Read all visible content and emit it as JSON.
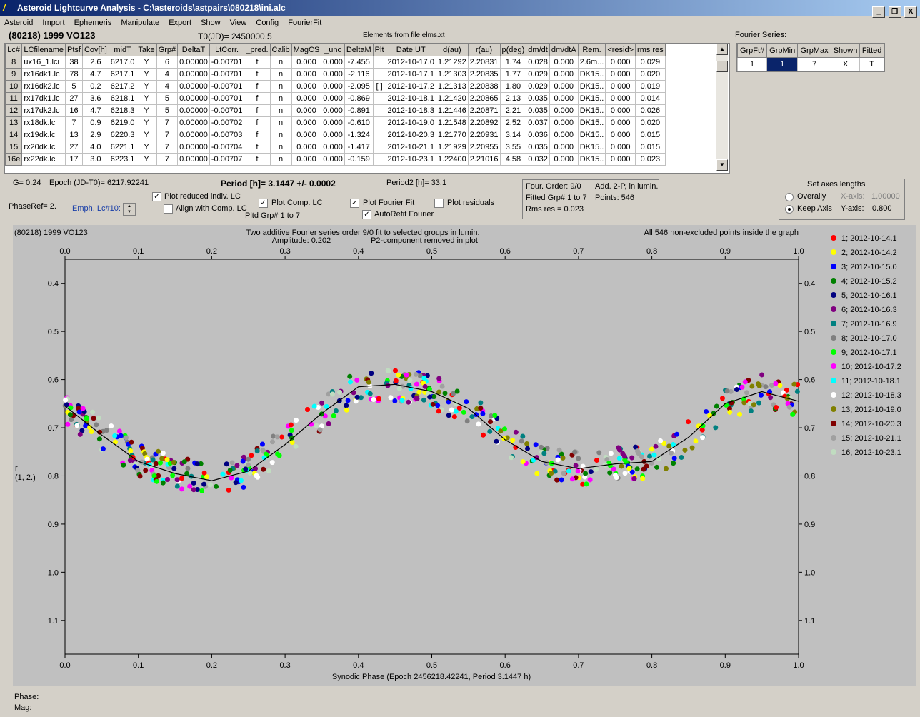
{
  "window": {
    "title": "Asteroid Lightcurve Analysis - C:\\asteroids\\astpairs\\080218\\ini.alc",
    "minimize": "_",
    "restore": "❐",
    "close": "X"
  },
  "menu": [
    "Asteroid",
    "Import",
    "Ephemeris",
    "Manipulate",
    "Export",
    "Show",
    "View",
    "Config",
    "FourierFit"
  ],
  "header": {
    "asteroid": "(80218) 1999 VO123",
    "t0": "T0(JD)= 2450000.5",
    "elements": "Elements from file elms.xt",
    "fourier_label": "Fourier Series:"
  },
  "lc_table": {
    "columns": [
      "Lc#",
      "LCfilename",
      "Ptsf",
      "Cov[h]",
      "midT",
      "Take",
      "Grp#",
      "DeltaT",
      "LtCorr.",
      "_pred.",
      "Calib",
      "MagCS",
      "_unc",
      "DeltaM",
      "Plt",
      "Date UT",
      "d(au)",
      "r(au)",
      "p(deg)",
      "dm/dt",
      "dm/dtA",
      "Rem.",
      "<resid>",
      "rms res"
    ],
    "rows": [
      [
        "8",
        "ux16_1.lci",
        "38",
        "2.6",
        "6217.0",
        "Y",
        "6",
        "0.00000",
        "-0.00701",
        "f",
        "n",
        "0.000",
        "0.000",
        "-7.455",
        "",
        "2012-10-17.0",
        "1.21292",
        "2.20831",
        "1.74",
        "0.028",
        "0.000",
        "2.6m...",
        "0.000",
        "0.029"
      ],
      [
        "9",
        "rx16dk1.lc",
        "78",
        "4.7",
        "6217.1",
        "Y",
        "4",
        "0.00000",
        "-0.00701",
        "f",
        "n",
        "0.000",
        "0.000",
        "-2.116",
        "",
        "2012-10-17.1",
        "1.21303",
        "2.20835",
        "1.77",
        "0.029",
        "0.000",
        "DK15..",
        "0.000",
        "0.020"
      ],
      [
        "10",
        "rx16dk2.lc",
        "5",
        "0.2",
        "6217.2",
        "Y",
        "4",
        "0.00000",
        "-0.00701",
        "f",
        "n",
        "0.000",
        "0.000",
        "-2.095",
        "[ ]",
        "2012-10-17.2",
        "1.21313",
        "2.20838",
        "1.80",
        "0.029",
        "0.000",
        "DK15..",
        "0.000",
        "0.019"
      ],
      [
        "11",
        "rx17dk1.lc",
        "27",
        "3.6",
        "6218.1",
        "Y",
        "5",
        "0.00000",
        "-0.00701",
        "f",
        "n",
        "0.000",
        "0.000",
        "-0.869",
        "",
        "2012-10-18.1",
        "1.21420",
        "2.20865",
        "2.13",
        "0.035",
        "0.000",
        "DK15..",
        "0.000",
        "0.014"
      ],
      [
        "12",
        "rx17dk2.lc",
        "16",
        "4.7",
        "6218.3",
        "Y",
        "5",
        "0.00000",
        "-0.00701",
        "f",
        "n",
        "0.000",
        "0.000",
        "-0.891",
        "",
        "2012-10-18.3",
        "1.21446",
        "2.20871",
        "2.21",
        "0.035",
        "0.000",
        "DK15..",
        "0.000",
        "0.026"
      ],
      [
        "13",
        "rx18dk.lc",
        "7",
        "0.9",
        "6219.0",
        "Y",
        "7",
        "0.00000",
        "-0.00702",
        "f",
        "n",
        "0.000",
        "0.000",
        "-0.610",
        "",
        "2012-10-19.0",
        "1.21548",
        "2.20892",
        "2.52",
        "0.037",
        "0.000",
        "DK15..",
        "0.000",
        "0.020"
      ],
      [
        "14",
        "rx19dk.lc",
        "13",
        "2.9",
        "6220.3",
        "Y",
        "7",
        "0.00000",
        "-0.00703",
        "f",
        "n",
        "0.000",
        "0.000",
        "-1.324",
        "",
        "2012-10-20.3",
        "1.21770",
        "2.20931",
        "3.14",
        "0.036",
        "0.000",
        "DK15..",
        "0.000",
        "0.015"
      ],
      [
        "15",
        "rx20dk.lc",
        "27",
        "4.0",
        "6221.1",
        "Y",
        "7",
        "0.00000",
        "-0.00704",
        "f",
        "n",
        "0.000",
        "0.000",
        "-1.417",
        "",
        "2012-10-21.1",
        "1.21929",
        "2.20955",
        "3.55",
        "0.035",
        "0.000",
        "DK15..",
        "0.000",
        "0.015"
      ],
      [
        "16e",
        "rx22dk.lc",
        "17",
        "3.0",
        "6223.1",
        "Y",
        "7",
        "0.00000",
        "-0.00707",
        "f",
        "n",
        "0.000",
        "0.000",
        "-0.159",
        "",
        "2012-10-23.1",
        "1.22400",
        "2.21016",
        "4.58",
        "0.032",
        "0.000",
        "DK15..",
        "0.000",
        "0.023"
      ]
    ]
  },
  "fourier_table": {
    "columns": [
      "GrpFt#",
      "GrpMin",
      "GrpMax",
      "Shown",
      "Fitted"
    ],
    "row": [
      "1",
      "1",
      "7",
      "X",
      "T"
    ]
  },
  "info": {
    "g": "G= 0.24",
    "epoch": "Epoch (JD-T0)= 6217.92241",
    "period": "Period [h]= 3.1447 +/- 0.0002",
    "period2": "Period2 [h]= 33.1",
    "phaseref": "PhaseRef= 2.",
    "emph": "Emph. Lc#10:",
    "cb_reduced": "Plot reduced indiv. LC",
    "cb_align": "Align with Comp. LC",
    "cb_comp": "Plot Comp. LC",
    "pltd_grp": "Pltd Grp#  1   to   7",
    "cb_fourier": "Plot Fourier Fit",
    "cb_autorefit": "AutoRefit Fourier",
    "cb_resid": "Plot residuals",
    "four_order": "Four. Order:  9/0",
    "add2p": "Add. 2-P, in lumin.",
    "fitted_grp": "Fitted Grp# 1 to 7",
    "points": "Points: 546",
    "rms": "Rms res     = 0.023"
  },
  "axes_box": {
    "title": "Set axes lengths",
    "overally": "Overally",
    "keep": "Keep Axis",
    "xaxis_label": "X-axis:",
    "xaxis_value": "1.00000",
    "yaxis_label": "Y-axis:",
    "yaxis_value": "0.800"
  },
  "chart_data": {
    "type": "scatter",
    "title_left": "(80218) 1999 VO123",
    "title_center": "Two additive Fourier series order 9/0 fit to selected groups in lumin.",
    "subtitle_a": "Amplitude: 0.202",
    "subtitle_b": "P2-component removed in plot",
    "title_right": "All 546 non-excluded points inside the graph",
    "xlabel": "Synodic Phase (Epoch 2456218.42241, Period 3.1447 h)",
    "ylabel": [
      "r",
      "(1, 2.)"
    ],
    "xlim": [
      0.0,
      1.0
    ],
    "ylim": [
      1.17,
      0.35
    ],
    "xticks": [
      "0.0",
      "0.1",
      "0.2",
      "0.3",
      "0.4",
      "0.5",
      "0.6",
      "0.7",
      "0.8",
      "0.9",
      "1.0"
    ],
    "yticks": [
      "0.4",
      "0.5",
      "0.6",
      "0.7",
      "0.8",
      "0.9",
      "1.0",
      "1.1"
    ],
    "fit_curve": {
      "x": [
        0.0,
        0.05,
        0.1,
        0.15,
        0.2,
        0.25,
        0.3,
        0.35,
        0.4,
        0.45,
        0.5,
        0.55,
        0.6,
        0.65,
        0.7,
        0.75,
        0.8,
        0.85,
        0.9,
        0.95,
        1.0
      ],
      "y": [
        0.655,
        0.715,
        0.77,
        0.795,
        0.81,
        0.79,
        0.735,
        0.67,
        0.615,
        0.61,
        0.625,
        0.66,
        0.725,
        0.77,
        0.785,
        0.775,
        0.77,
        0.72,
        0.65,
        0.625,
        0.645
      ]
    },
    "scatter_y_range_note": "points scatter around fit curve",
    "series": [
      {
        "name": "1; 2012-10-14.1",
        "color": "#ff0000"
      },
      {
        "name": "2; 2012-10-14.2",
        "color": "#ffff00"
      },
      {
        "name": "3; 2012-10-15.0",
        "color": "#0000ff"
      },
      {
        "name": "4; 2012-10-15.2",
        "color": "#008000"
      },
      {
        "name": "5; 2012-10-16.1",
        "color": "#000080"
      },
      {
        "name": "6; 2012-10-16.3",
        "color": "#800080"
      },
      {
        "name": "7; 2012-10-16.9",
        "color": "#008080"
      },
      {
        "name": "8; 2012-10-17.0",
        "color": "#808080"
      },
      {
        "name": "9; 2012-10-17.1",
        "color": "#00ff00"
      },
      {
        "name": "10; 2012-10-17.2",
        "color": "#ff00ff"
      },
      {
        "name": "11; 2012-10-18.1",
        "color": "#00ffff"
      },
      {
        "name": "12; 2012-10-18.3",
        "color": "#ffffff"
      },
      {
        "name": "13; 2012-10-19.0",
        "color": "#808000"
      },
      {
        "name": "14; 2012-10-20.3",
        "color": "#800000"
      },
      {
        "name": "15; 2012-10-21.1",
        "color": "#a0a0a0"
      },
      {
        "name": "16; 2012-10-23.1",
        "color": "#c0dcc0"
      }
    ]
  },
  "status": {
    "phase": "Phase:",
    "mag": "Mag:"
  }
}
